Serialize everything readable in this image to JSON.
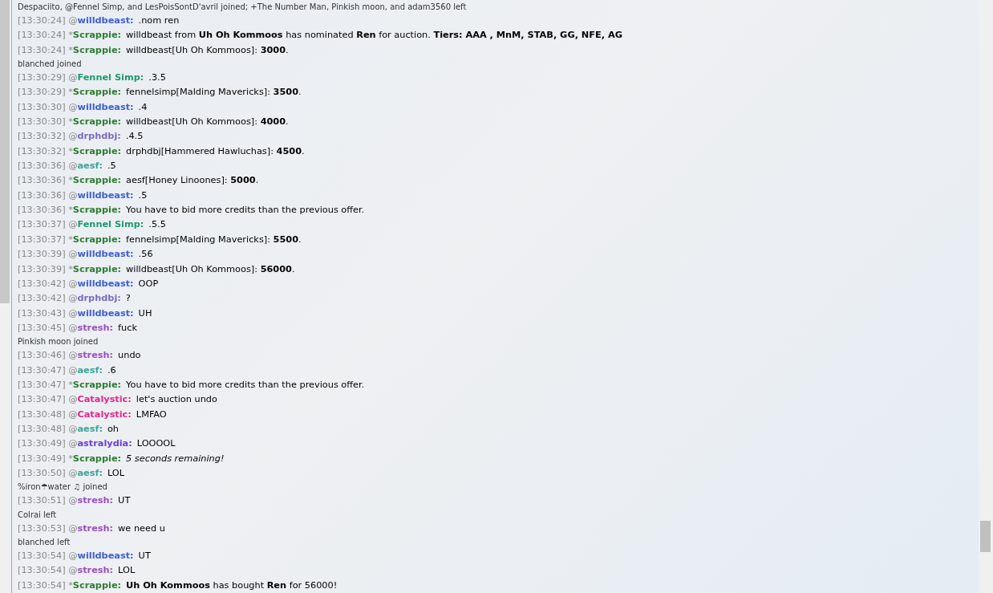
{
  "lines": [
    {
      "kind": "notice",
      "text": "Despaciito, @Fennel Simp, and LesPoisSontD'avril joined; +The Number Man, Pinkish moon, and adam3560 left"
    },
    {
      "kind": "chat",
      "time": "[13:30:24]",
      "prefix": "@",
      "user": "willdbeast:",
      "color": "#3d5fd6",
      "message": ".nom ren"
    },
    {
      "kind": "chat",
      "time": "[13:30:24]",
      "prefix": "*",
      "user": "Scrappie:",
      "color": "#2e7d32",
      "message": "willdbeast from **Uh Oh Kommoos** has nominated **Ren** for auction. **Tiers: AAA , MnM, STAB, GG, NFE, AG**"
    },
    {
      "kind": "chat",
      "time": "[13:30:24]",
      "prefix": "*",
      "user": "Scrappie:",
      "color": "#2e7d32",
      "message": "willdbeast[Uh Oh Kommoos]: **3000**."
    },
    {
      "kind": "notice",
      "text": "blanched joined"
    },
    {
      "kind": "chat",
      "time": "[13:30:29]",
      "prefix": "@",
      "user": "Fennel Simp:",
      "color": "#1f9a6c",
      "message": ".3.5"
    },
    {
      "kind": "chat",
      "time": "[13:30:29]",
      "prefix": "*",
      "user": "Scrappie:",
      "color": "#2e7d32",
      "message": "fennelsimp[Malding Mavericks]: **3500**."
    },
    {
      "kind": "chat",
      "time": "[13:30:30]",
      "prefix": "@",
      "user": "willdbeast:",
      "color": "#3d5fd6",
      "message": ".4"
    },
    {
      "kind": "chat",
      "time": "[13:30:30]",
      "prefix": "*",
      "user": "Scrappie:",
      "color": "#2e7d32",
      "message": "willdbeast[Uh Oh Kommoos]: **4000**."
    },
    {
      "kind": "chat",
      "time": "[13:30:32]",
      "prefix": "@",
      "user": "drphdbj:",
      "color": "#7b6bc4",
      "message": ".4.5"
    },
    {
      "kind": "chat",
      "time": "[13:30:32]",
      "prefix": "*",
      "user": "Scrappie:",
      "color": "#2e7d32",
      "message": "drphdbj[Hammered Hawluchas]: **4500**."
    },
    {
      "kind": "chat",
      "time": "[13:30:36]",
      "prefix": "@",
      "user": "aesf:",
      "color": "#3aa59c",
      "message": ".5"
    },
    {
      "kind": "chat",
      "time": "[13:30:36]",
      "prefix": "*",
      "user": "Scrappie:",
      "color": "#2e7d32",
      "message": "aesf[Honey Linoones]: **5000**."
    },
    {
      "kind": "chat",
      "time": "[13:30:36]",
      "prefix": "@",
      "user": "willdbeast:",
      "color": "#3d5fd6",
      "message": ".5"
    },
    {
      "kind": "chat",
      "time": "[13:30:36]",
      "prefix": "*",
      "user": "Scrappie:",
      "color": "#2e7d32",
      "message": "You have to bid more credits than the previous offer."
    },
    {
      "kind": "chat",
      "time": "[13:30:37]",
      "prefix": "@",
      "user": "Fennel Simp:",
      "color": "#1f9a6c",
      "message": ".5.5"
    },
    {
      "kind": "chat",
      "time": "[13:30:37]",
      "prefix": "*",
      "user": "Scrappie:",
      "color": "#2e7d32",
      "message": "fennelsimp[Malding Mavericks]: **5500**."
    },
    {
      "kind": "chat",
      "time": "[13:30:39]",
      "prefix": "@",
      "user": "willdbeast:",
      "color": "#3d5fd6",
      "message": ".56"
    },
    {
      "kind": "chat",
      "time": "[13:30:39]",
      "prefix": "*",
      "user": "Scrappie:",
      "color": "#2e7d32",
      "message": "willdbeast[Uh Oh Kommoos]: **56000**."
    },
    {
      "kind": "chat",
      "time": "[13:30:42]",
      "prefix": "@",
      "user": "willdbeast:",
      "color": "#3d5fd6",
      "message": "OOP"
    },
    {
      "kind": "chat",
      "time": "[13:30:42]",
      "prefix": "@",
      "user": "drphdbj:",
      "color": "#7b6bc4",
      "message": "?"
    },
    {
      "kind": "chat",
      "time": "[13:30:43]",
      "prefix": "@",
      "user": "willdbeast:",
      "color": "#3d5fd6",
      "message": "UH"
    },
    {
      "kind": "chat",
      "time": "[13:30:45]",
      "prefix": "@",
      "user": "stresh:",
      "color": "#9a4fc2",
      "message": "fuck"
    },
    {
      "kind": "notice",
      "text": "Pinkish moon joined"
    },
    {
      "kind": "chat",
      "time": "[13:30:46]",
      "prefix": "@",
      "user": "stresh:",
      "color": "#9a4fc2",
      "message": "undo"
    },
    {
      "kind": "chat",
      "time": "[13:30:47]",
      "prefix": "@",
      "user": "aesf:",
      "color": "#3aa59c",
      "message": ".6"
    },
    {
      "kind": "chat",
      "time": "[13:30:47]",
      "prefix": "*",
      "user": "Scrappie:",
      "color": "#2e7d32",
      "message": "You have to bid more credits than the previous offer."
    },
    {
      "kind": "chat",
      "time": "[13:30:47]",
      "prefix": "@",
      "user": "Catalystic:",
      "color": "#e0288c",
      "message": "let's auction undo"
    },
    {
      "kind": "chat",
      "time": "[13:30:48]",
      "prefix": "@",
      "user": "Catalystic:",
      "color": "#e0288c",
      "message": "LMFAO"
    },
    {
      "kind": "chat",
      "time": "[13:30:48]",
      "prefix": "@",
      "user": "aesf:",
      "color": "#3aa59c",
      "message": "oh"
    },
    {
      "kind": "chat",
      "time": "[13:30:49]",
      "prefix": "@",
      "user": "astralydia:",
      "color": "#6a3fe0",
      "message": "LOOOOL"
    },
    {
      "kind": "chat",
      "time": "[13:30:49]",
      "prefix": "*",
      "user": "Scrappie:",
      "color": "#2e7d32",
      "message": "5 seconds remaining!",
      "italic": true
    },
    {
      "kind": "chat",
      "time": "[13:30:50]",
      "prefix": "@",
      "user": "aesf:",
      "color": "#3aa59c",
      "message": "LOL"
    },
    {
      "kind": "notice",
      "text": "%iron☂water ♫ joined"
    },
    {
      "kind": "chat",
      "time": "[13:30:51]",
      "prefix": "@",
      "user": "stresh:",
      "color": "#9a4fc2",
      "message": "UT"
    },
    {
      "kind": "notice",
      "text": "Colrai left"
    },
    {
      "kind": "chat",
      "time": "[13:30:53]",
      "prefix": "@",
      "user": "stresh:",
      "color": "#9a4fc2",
      "message": "we need u"
    },
    {
      "kind": "notice",
      "text": "blanched left"
    },
    {
      "kind": "chat",
      "time": "[13:30:54]",
      "prefix": "@",
      "user": "willdbeast:",
      "color": "#3d5fd6",
      "message": "UT"
    },
    {
      "kind": "chat",
      "time": "[13:30:54]",
      "prefix": "@",
      "user": "stresh:",
      "color": "#9a4fc2",
      "message": "LOL"
    },
    {
      "kind": "chat",
      "time": "[13:30:54]",
      "prefix": "*",
      "user": "Scrappie:",
      "color": "#2e7d32",
      "message": "**Uh Oh Kommoos** has bought **Ren** for 56000!"
    }
  ]
}
